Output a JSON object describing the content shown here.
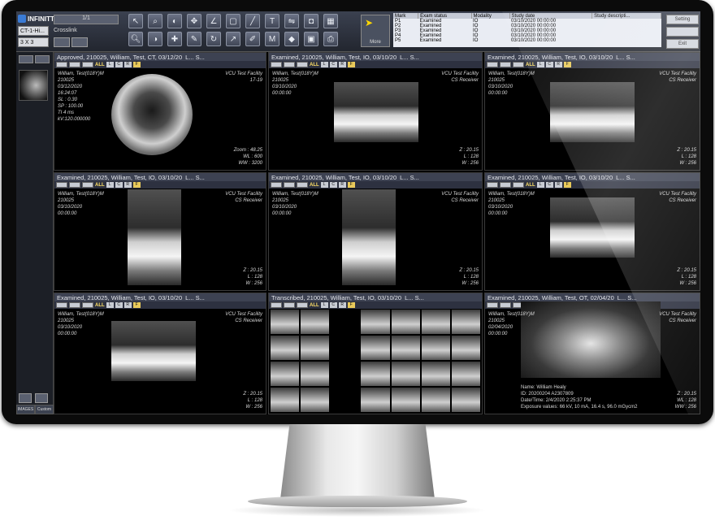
{
  "app": {
    "brand": "INFINITT",
    "layout_select": "CT-1-Hi...",
    "layout_grid": "3 X 3",
    "pager": "1/1",
    "crosslink_label": "Crosslink",
    "more_label": "More",
    "side_buttons": [
      "Setting",
      "Exit"
    ]
  },
  "worklist": {
    "headers": [
      "Mark",
      "Exam status",
      "Modality",
      "Study date",
      "Study descripti..."
    ],
    "rows": [
      [
        "P1",
        "Examined",
        "IO",
        "03/10/2020 00:00:00",
        ""
      ],
      [
        "P2",
        "Examined",
        "IO",
        "03/10/2020 00:00:00",
        ""
      ],
      [
        "P3",
        "Examined",
        "IO",
        "03/10/2020 00:00:00",
        ""
      ],
      [
        "P4",
        "Examined",
        "IO",
        "03/10/2020 00:00:00",
        ""
      ],
      [
        "P5",
        "Examined",
        "IO",
        "03/10/2020 00:00:00",
        ""
      ]
    ]
  },
  "left_panel": {
    "tabs": [
      "IMAGES",
      "Custom"
    ]
  },
  "viewports": [
    {
      "title": "Approved, 210025, William, Test, CT, 03/12/20",
      "suffix": "L... S...",
      "tl": [
        "William, Test(018Y)M",
        "210025",
        "03/12/2020",
        "16:24:07",
        "",
        "SL : 0.30",
        "SP : 100.00",
        "",
        "",
        "",
        "TI 4 ms",
        "kV:120.000000"
      ],
      "tr": [
        "VCU Test Facility",
        "17-19"
      ],
      "br": [
        "Zoom : 48.25",
        "WL : 600",
        "WW : 3200"
      ]
    },
    {
      "title": "Examined, 210025, William, Test, IO, 03/10/20",
      "suffix": "L... S...",
      "tl": [
        "William, Test(018Y)M",
        "210025",
        "03/10/2020",
        "00:00:00"
      ],
      "tr": [
        "VCU Test Facility",
        "CS Receiver"
      ],
      "br": [
        "Z : 20.15",
        "L : 128",
        "W : 256"
      ]
    },
    {
      "title": "Examined, 210025, William, Test, IO, 03/10/20",
      "suffix": "L... S...",
      "tl": [
        "William, Test(018Y)M",
        "210025",
        "03/10/2020",
        "00:00:00"
      ],
      "tr": [
        "VCU Test Facility",
        "CS Receiver"
      ],
      "br": [
        "Z : 20.15",
        "L : 128",
        "W : 256"
      ]
    },
    {
      "title": "Examined, 210025, William, Test, IO, 03/10/20",
      "suffix": "L... S...",
      "tl": [
        "William, Test(018Y)M",
        "210025",
        "03/10/2020",
        "00:00:00"
      ],
      "tr": [
        "VCU Test Facility",
        "CS Receiver"
      ],
      "br": [
        "Z : 20.15",
        "L : 128",
        "W : 256"
      ]
    },
    {
      "title": "Examined, 210025, William, Test, IO, 03/10/20",
      "suffix": "L... S...",
      "tl": [
        "William, Test(018Y)M",
        "210025",
        "03/10/2020",
        "00:00:00"
      ],
      "tr": [
        "VCU Test Facility",
        "CS Receiver"
      ],
      "br": [
        "Z : 20.15",
        "L : 128",
        "W : 256"
      ]
    },
    {
      "title": "Examined, 210025, William, Test, IO, 03/10/20",
      "suffix": "L... S...",
      "tl": [
        "William, Test(018Y)M",
        "210025",
        "03/10/2020",
        "00:00:00"
      ],
      "tr": [
        "VCU Test Facility",
        "CS Receiver"
      ],
      "br": [
        "Z : 20.15",
        "L : 128",
        "W : 256"
      ]
    },
    {
      "title": "Examined, 210025, William, Test, IO, 03/10/20",
      "suffix": "L... S...",
      "tl": [
        "William, Test(018Y)M",
        "210025",
        "03/10/2020",
        "00:00:00"
      ],
      "tr": [
        "VCU Test Facility",
        "CS Receiver"
      ],
      "br": [
        "Z : 20.15",
        "L : 128",
        "W : 256"
      ]
    },
    {
      "title": "Transcribed, 210025, William, Test, IO, 03/10/20",
      "suffix": "L... S...",
      "tl": [],
      "tr": [],
      "br": []
    },
    {
      "title": "Examined, 210025, William, Test, OT, 02/04/20",
      "suffix": "L... S...",
      "tl": [
        "William, Test(018Y)M",
        "210025",
        "02/04/2020",
        "00:00:00"
      ],
      "tr": [
        "VCU Test Facility",
        "CS Receiver"
      ],
      "br": [
        "Z : 20.15",
        "WL : 128",
        "WW : 256"
      ],
      "caption": [
        "Name: William Healy",
        "ID: 20200204 A2307809",
        "Date/Time: 2/4/2020 2:25:37 PM",
        "Exposure values: 66 kV, 10 mA, 16.4 s, 96.0 mGycm2"
      ]
    }
  ],
  "vp_tools": {
    "all": "ALL",
    "buttons": [
      "L",
      "C",
      "R",
      "F"
    ]
  }
}
